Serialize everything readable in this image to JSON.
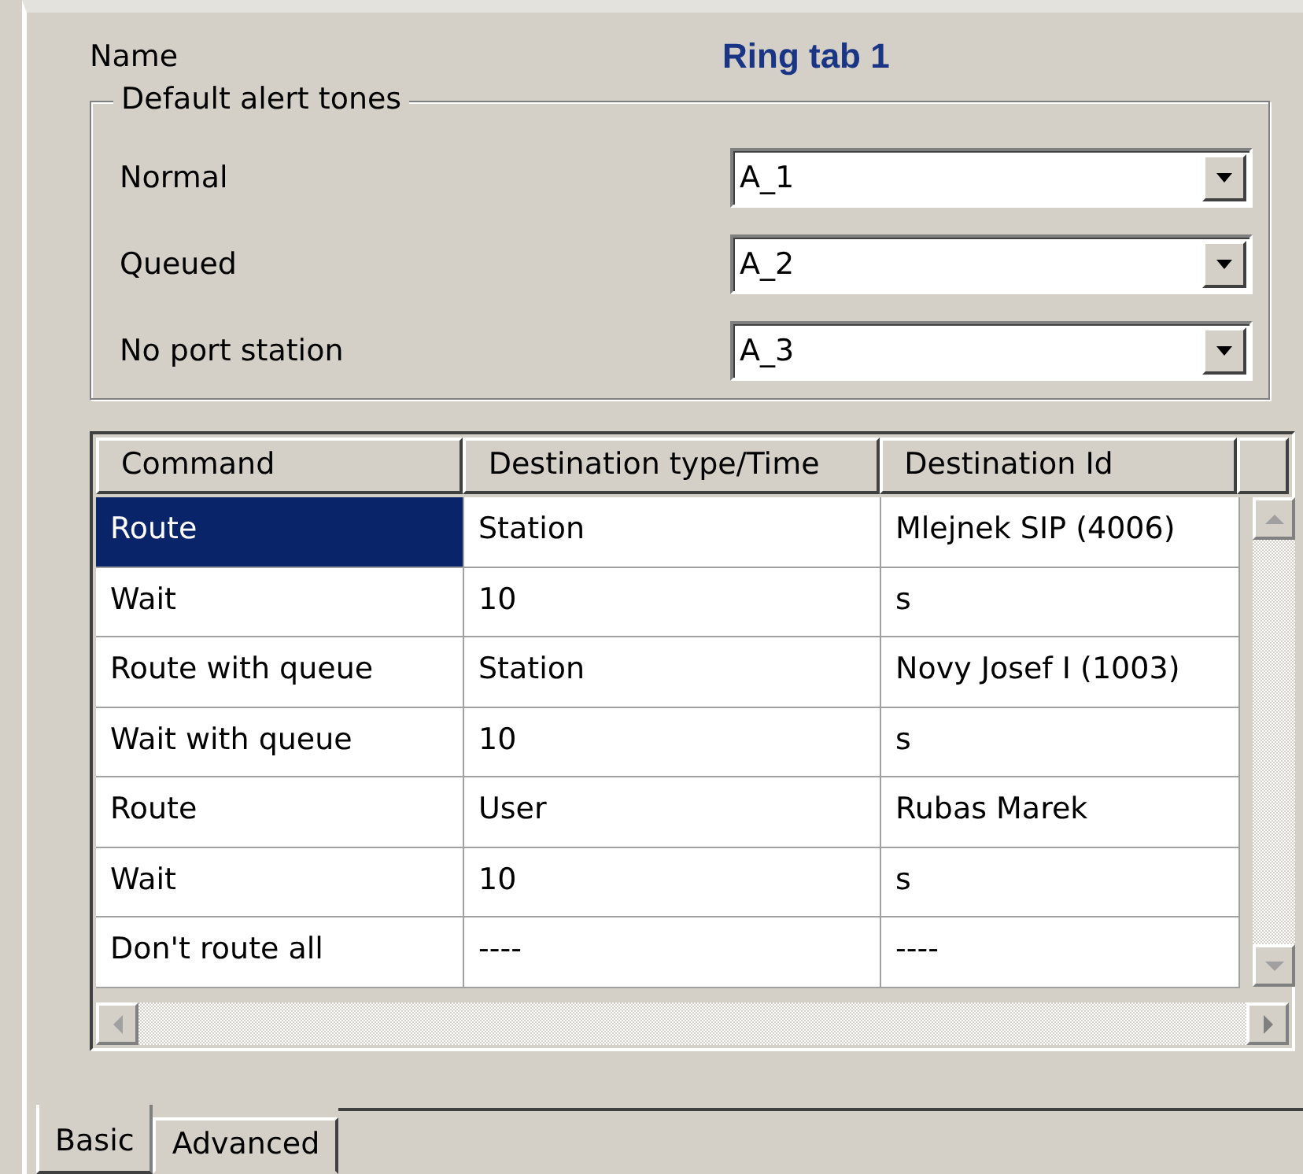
{
  "name_label": "Name",
  "name_value": "Ring tab 1",
  "alert_tones": {
    "title": "Default alert tones",
    "rows": [
      {
        "label": "Normal",
        "value": "A_1"
      },
      {
        "label": "Queued",
        "value": "A_2"
      },
      {
        "label": "No port station",
        "value": "A_3"
      }
    ]
  },
  "table": {
    "columns": [
      "Command",
      "Destination type/Time",
      "Destination Id"
    ],
    "rows": [
      {
        "selected": true,
        "cells": [
          "Route",
          "Station",
          "Mlejnek SIP (4006)"
        ]
      },
      {
        "selected": false,
        "cells": [
          "Wait",
          "10",
          "s"
        ]
      },
      {
        "selected": false,
        "cells": [
          "Route with queue",
          "Station",
          "Novy Josef I (1003)"
        ]
      },
      {
        "selected": false,
        "cells": [
          "Wait with queue",
          "10",
          "s"
        ]
      },
      {
        "selected": false,
        "cells": [
          "Route",
          "User",
          "Rubas Marek"
        ]
      },
      {
        "selected": false,
        "cells": [
          "Wait",
          "10",
          "s"
        ]
      },
      {
        "selected": false,
        "cells": [
          "Don't route all",
          "----",
          "----"
        ]
      }
    ]
  },
  "tabs": [
    {
      "label": "Basic",
      "selected": true
    },
    {
      "label": "Advanced",
      "selected": false
    }
  ]
}
